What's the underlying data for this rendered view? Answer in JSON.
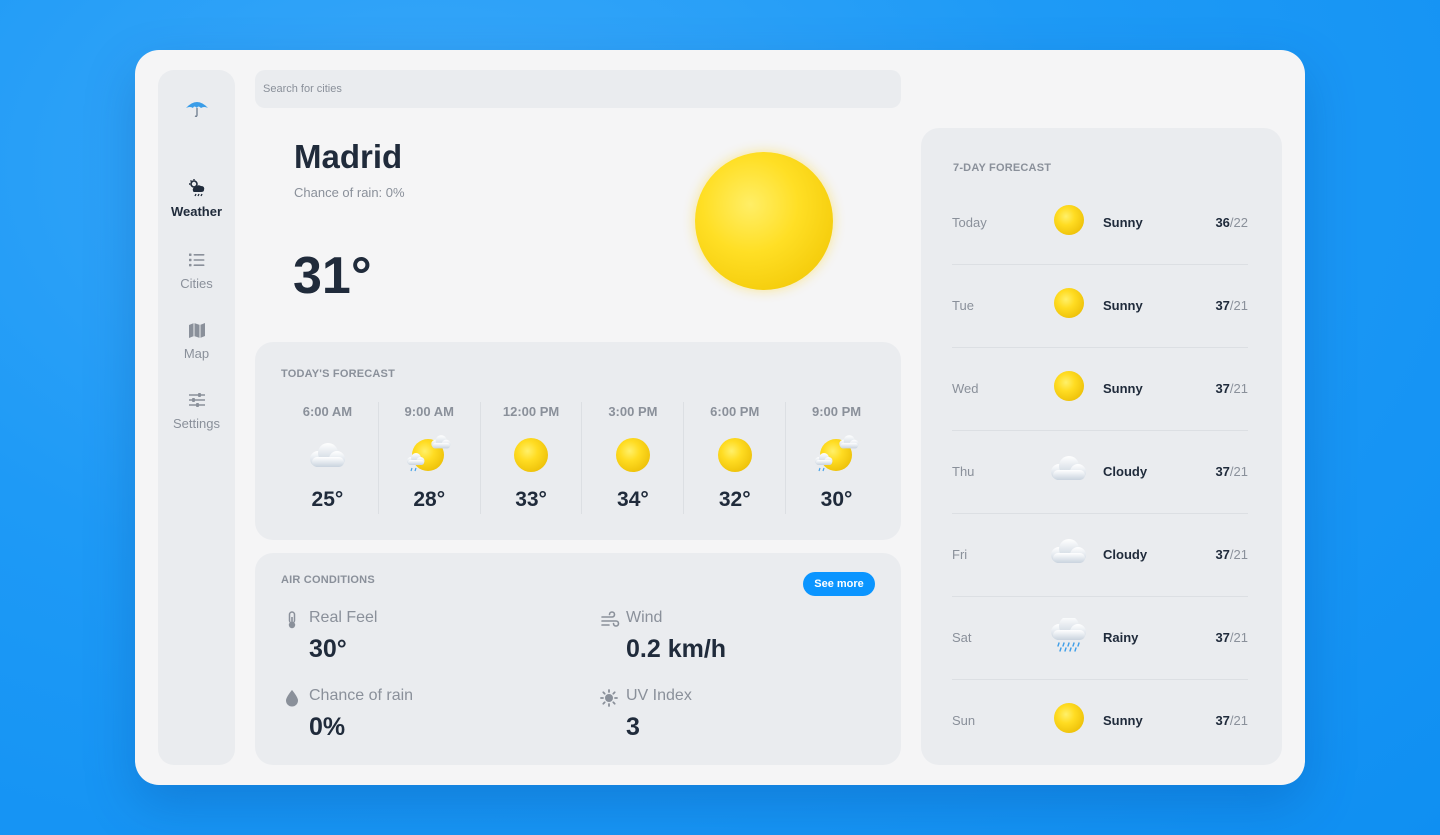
{
  "search": {
    "placeholder": "Search for cities"
  },
  "sidebar": {
    "items": [
      {
        "label": "Weather",
        "icon": "cloud-sun-rain-icon",
        "active": true
      },
      {
        "label": "Cities",
        "icon": "list-icon",
        "active": false
      },
      {
        "label": "Map",
        "icon": "map-icon",
        "active": false
      },
      {
        "label": "Settings",
        "icon": "sliders-icon",
        "active": false
      }
    ]
  },
  "current": {
    "city": "Madrid",
    "rain_chance": "Chance of rain: 0%",
    "temperature": "31°",
    "icon": "sun-icon"
  },
  "today_forecast": {
    "title": "TODAY'S FORECAST",
    "hours": [
      {
        "time": "6:00 AM",
        "temp": "25°",
        "icon": "cloud-icon"
      },
      {
        "time": "9:00 AM",
        "temp": "28°",
        "icon": "sun-cloud-rain-icon"
      },
      {
        "time": "12:00 PM",
        "temp": "33°",
        "icon": "sun-icon"
      },
      {
        "time": "3:00 PM",
        "temp": "34°",
        "icon": "sun-icon"
      },
      {
        "time": "6:00 PM",
        "temp": "32°",
        "icon": "sun-icon"
      },
      {
        "time": "9:00 PM",
        "temp": "30°",
        "icon": "sun-cloud-rain-icon"
      }
    ]
  },
  "air_conditions": {
    "title": "AIR CONDITIONS",
    "see_more": "See more",
    "items": [
      {
        "label": "Real Feel",
        "value": "30°",
        "icon": "thermometer-icon"
      },
      {
        "label": "Wind",
        "value": "0.2 km/h",
        "icon": "wind-icon"
      },
      {
        "label": "Chance of rain",
        "value": "0%",
        "icon": "droplet-icon"
      },
      {
        "label": "UV Index",
        "value": "3",
        "icon": "sun-uv-icon"
      }
    ]
  },
  "week_forecast": {
    "title": "7-DAY FORECAST",
    "days": [
      {
        "day": "Today",
        "condition": "Sunny",
        "high": "36",
        "low": "/22",
        "icon": "sun-icon"
      },
      {
        "day": "Tue",
        "condition": "Sunny",
        "high": "37",
        "low": "/21",
        "icon": "sun-icon"
      },
      {
        "day": "Wed",
        "condition": "Sunny",
        "high": "37",
        "low": "/21",
        "icon": "sun-icon"
      },
      {
        "day": "Thu",
        "condition": "Cloudy",
        "high": "37",
        "low": "/21",
        "icon": "cloud-icon"
      },
      {
        "day": "Fri",
        "condition": "Cloudy",
        "high": "37",
        "low": "/21",
        "icon": "cloud-icon"
      },
      {
        "day": "Sat",
        "condition": "Rainy",
        "high": "37",
        "low": "/21",
        "icon": "rain-cloud-icon"
      },
      {
        "day": "Sun",
        "condition": "Sunny",
        "high": "37",
        "low": "/21",
        "icon": "sun-icon"
      }
    ]
  },
  "colors": {
    "background": "#1e9af6",
    "accent": "#0b95ff",
    "text_primary": "#202b3b",
    "text_secondary": "#8a909a",
    "sun": "#ffdf25"
  }
}
